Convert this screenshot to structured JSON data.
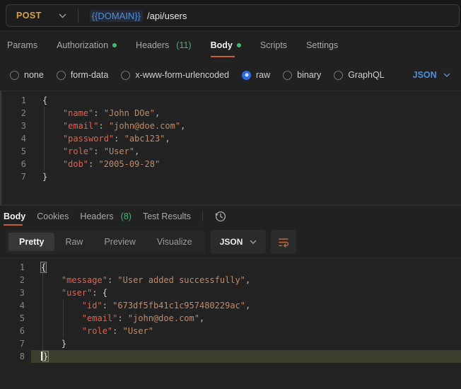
{
  "request": {
    "method": "POST",
    "url_variable": "{{DOMAIN}}",
    "url_path": "/api/users",
    "tabs": {
      "params": "Params",
      "authorization": "Authorization",
      "headers": "Headers",
      "headers_count": "(11)",
      "body": "Body",
      "scripts": "Scripts",
      "settings": "Settings"
    },
    "body_types": {
      "none": "none",
      "form_data": "form-data",
      "urlencoded": "x-www-form-urlencoded",
      "raw": "raw",
      "binary": "binary",
      "graphql": "GraphQL"
    },
    "selected_body_type": "raw",
    "language": "JSON"
  },
  "request_editor": {
    "lines": [
      {
        "num": "1",
        "tokens": [
          {
            "t": "brace",
            "v": "{"
          }
        ]
      },
      {
        "num": "2",
        "tokens": [
          {
            "t": "ws",
            "v": "    "
          },
          {
            "t": "key",
            "v": "\"name\""
          },
          {
            "t": "punct",
            "v": ": "
          },
          {
            "t": "str",
            "v": "\"John DOe\""
          },
          {
            "t": "punct",
            "v": ","
          }
        ]
      },
      {
        "num": "3",
        "tokens": [
          {
            "t": "ws",
            "v": "    "
          },
          {
            "t": "key",
            "v": "\"email\""
          },
          {
            "t": "punct",
            "v": ": "
          },
          {
            "t": "str",
            "v": "\"john@doe.com\""
          },
          {
            "t": "punct",
            "v": ","
          }
        ]
      },
      {
        "num": "4",
        "tokens": [
          {
            "t": "ws",
            "v": "    "
          },
          {
            "t": "key",
            "v": "\"password\""
          },
          {
            "t": "punct",
            "v": ": "
          },
          {
            "t": "str",
            "v": "\"abc123\""
          },
          {
            "t": "punct",
            "v": ","
          }
        ]
      },
      {
        "num": "5",
        "tokens": [
          {
            "t": "ws",
            "v": "    "
          },
          {
            "t": "key",
            "v": "\"role\""
          },
          {
            "t": "punct",
            "v": ": "
          },
          {
            "t": "str",
            "v": "\"User\""
          },
          {
            "t": "punct",
            "v": ","
          }
        ]
      },
      {
        "num": "6",
        "tokens": [
          {
            "t": "ws",
            "v": "    "
          },
          {
            "t": "key",
            "v": "\"dob\""
          },
          {
            "t": "punct",
            "v": ": "
          },
          {
            "t": "str",
            "v": "\"2005-09-28\""
          }
        ]
      },
      {
        "num": "7",
        "tokens": [
          {
            "t": "brace",
            "v": "}"
          }
        ]
      }
    ]
  },
  "response": {
    "tabs": {
      "body": "Body",
      "cookies": "Cookies",
      "headers": "Headers",
      "headers_count": "(8)",
      "test_results": "Test Results"
    },
    "views": {
      "pretty": "Pretty",
      "raw": "Raw",
      "preview": "Preview",
      "visualize": "Visualize"
    },
    "active_view": "Pretty",
    "format": "JSON"
  },
  "response_editor": {
    "lines": [
      {
        "num": "1",
        "tokens": [
          {
            "t": "brace_match",
            "v": "{"
          }
        ]
      },
      {
        "num": "2",
        "tokens": [
          {
            "t": "ws",
            "v": "    "
          },
          {
            "t": "key",
            "v": "\"message\""
          },
          {
            "t": "punct",
            "v": ": "
          },
          {
            "t": "str",
            "v": "\"User added successfully\""
          },
          {
            "t": "punct",
            "v": ","
          }
        ]
      },
      {
        "num": "3",
        "tokens": [
          {
            "t": "ws",
            "v": "    "
          },
          {
            "t": "key",
            "v": "\"user\""
          },
          {
            "t": "punct",
            "v": ": "
          },
          {
            "t": "brace",
            "v": "{"
          }
        ]
      },
      {
        "num": "4",
        "tokens": [
          {
            "t": "ws",
            "v": "        "
          },
          {
            "t": "key",
            "v": "\"id\""
          },
          {
            "t": "punct",
            "v": ": "
          },
          {
            "t": "str",
            "v": "\"673df5fb41c1c957480229ac\""
          },
          {
            "t": "punct",
            "v": ","
          }
        ]
      },
      {
        "num": "5",
        "tokens": [
          {
            "t": "ws",
            "v": "        "
          },
          {
            "t": "key",
            "v": "\"email\""
          },
          {
            "t": "punct",
            "v": ": "
          },
          {
            "t": "str",
            "v": "\"john@doe.com\""
          },
          {
            "t": "punct",
            "v": ","
          }
        ]
      },
      {
        "num": "6",
        "tokens": [
          {
            "t": "ws",
            "v": "        "
          },
          {
            "t": "key",
            "v": "\"role\""
          },
          {
            "t": "punct",
            "v": ": "
          },
          {
            "t": "str",
            "v": "\"User\""
          }
        ]
      },
      {
        "num": "7",
        "tokens": [
          {
            "t": "ws",
            "v": "    "
          },
          {
            "t": "brace",
            "v": "}"
          }
        ]
      },
      {
        "num": "8",
        "current": true,
        "tokens": [
          {
            "t": "caret",
            "v": ""
          },
          {
            "t": "brace_match",
            "v": "}"
          }
        ]
      }
    ]
  },
  "colors": {
    "accent_orange": "#c75c35",
    "method_post_yellow": "#d9a33a",
    "link_blue": "#4c8fdd",
    "success_green": "#41b876",
    "json_key": "#e3604b",
    "json_string": "#c28a63",
    "current_line_bg": "#3d3e2e"
  },
  "icons": {
    "method_chevron": "chevron-down-icon",
    "history": "history-clock-icon",
    "wrap": "wrap-text-icon"
  }
}
